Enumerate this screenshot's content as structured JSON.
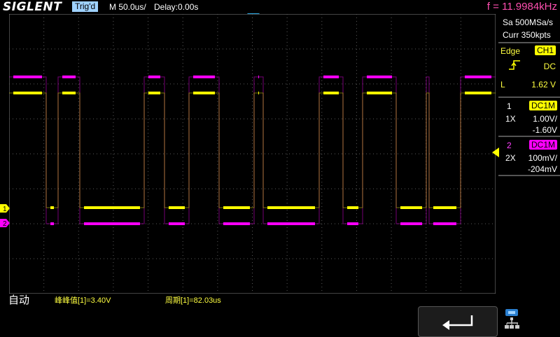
{
  "header": {
    "brand": "SIGLENT",
    "trigger_status": "Trig'd",
    "timebase": "M 50.0us/",
    "delay": "Delay:0.00s",
    "frequency": "f = 11.9984kHz"
  },
  "acquisition": {
    "sample_rate": "Sa 500MSa/s",
    "memory": "Curr 350kpts"
  },
  "trigger": {
    "type_label": "Edge",
    "source": "CH1",
    "coupling": "DC",
    "level_label": "L",
    "level": "1.62 V"
  },
  "channel1": {
    "number": "1",
    "coupling": "DC1M",
    "probe": "1X",
    "scale": "1.00V/",
    "offset": "-1.60V",
    "color": "#ffff00"
  },
  "channel2": {
    "number": "2",
    "coupling": "DC1M",
    "probe": "2X",
    "scale": "100mV/",
    "offset": "-204mV",
    "color": "#ff00ff"
  },
  "bottom": {
    "mode": "自动",
    "measurement1": "峰峰值[1]=3.40V",
    "measurement2": "周期[1]=82.03us"
  },
  "icons": {
    "back": "return-arrow-icon",
    "network": "network-icon"
  }
}
